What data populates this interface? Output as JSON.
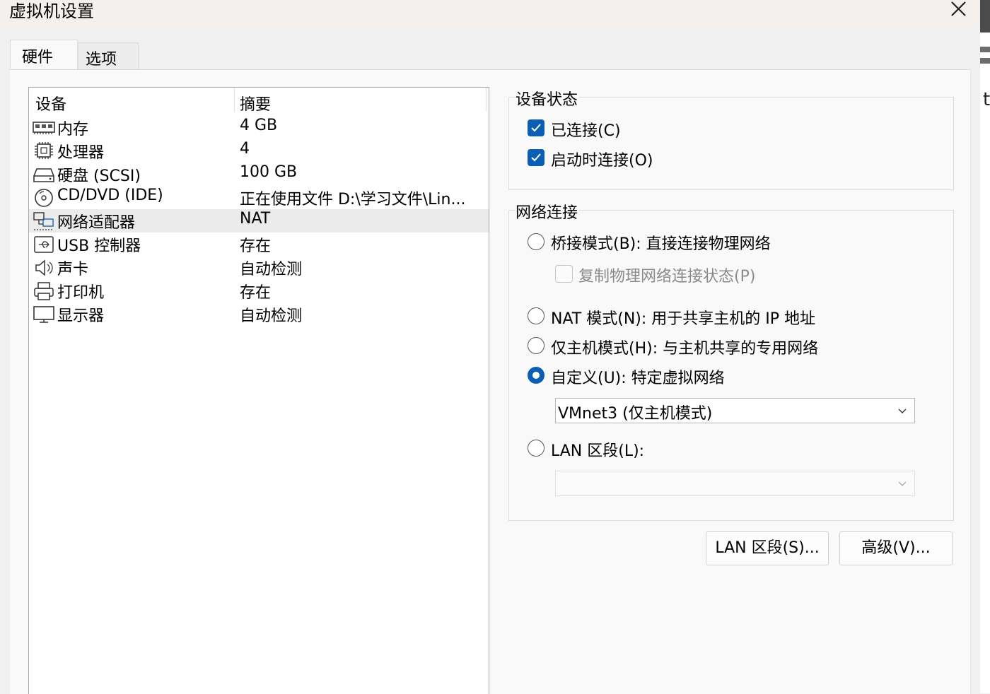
{
  "window": {
    "title": "虚拟机设置"
  },
  "tabs": [
    {
      "label": "硬件",
      "active": true
    },
    {
      "label": "选项",
      "active": false
    }
  ],
  "device_table": {
    "columns": [
      "设备",
      "摘要"
    ],
    "rows": [
      {
        "icon": "memory-icon",
        "device": "内存",
        "summary": "4 GB"
      },
      {
        "icon": "cpu-icon",
        "device": "处理器",
        "summary": "4"
      },
      {
        "icon": "hard-disk-icon",
        "device": "硬盘 (SCSI)",
        "summary": "100 GB"
      },
      {
        "icon": "cd-dvd-icon",
        "device": "CD/DVD (IDE)",
        "summary": "正在使用文件 D:\\学习文件\\Lin..."
      },
      {
        "icon": "network-adapter-icon",
        "device": "网络适配器",
        "summary": "NAT",
        "selected": true
      },
      {
        "icon": "usb-icon",
        "device": "USB 控制器",
        "summary": "存在"
      },
      {
        "icon": "speaker-icon",
        "device": "声卡",
        "summary": "自动检测"
      },
      {
        "icon": "printer-icon",
        "device": "打印机",
        "summary": "存在"
      },
      {
        "icon": "display-icon",
        "device": "显示器",
        "summary": "自动检测"
      }
    ]
  },
  "device_status": {
    "group_label": "设备状态",
    "connected": {
      "label": "已连接(C)",
      "checked": true
    },
    "connect_at_power_on": {
      "label": "启动时连接(O)",
      "checked": true
    }
  },
  "network_connection": {
    "group_label": "网络连接",
    "bridged": {
      "label": "桥接模式(B): 直接连接物理网络",
      "selected": false
    },
    "replicate": {
      "label": "复制物理网络连接状态(P)",
      "checked": false,
      "enabled": false
    },
    "nat": {
      "label": "NAT 模式(N): 用于共享主机的 IP 地址",
      "selected": false
    },
    "host_only": {
      "label": "仅主机模式(H): 与主机共享的专用网络",
      "selected": false
    },
    "custom": {
      "label": "自定义(U): 特定虚拟网络",
      "selected": true
    },
    "custom_select_value": "VMnet3 (仅主机模式)",
    "lan_segment": {
      "label": "LAN 区段(L):",
      "selected": false
    },
    "lan_select_value": ""
  },
  "buttons": {
    "lan_segments": "LAN 区段(S)...",
    "advanced": "高级(V)..."
  },
  "colors": {
    "accent": "#0a5fb4",
    "selected_row": "#ebebeb"
  }
}
